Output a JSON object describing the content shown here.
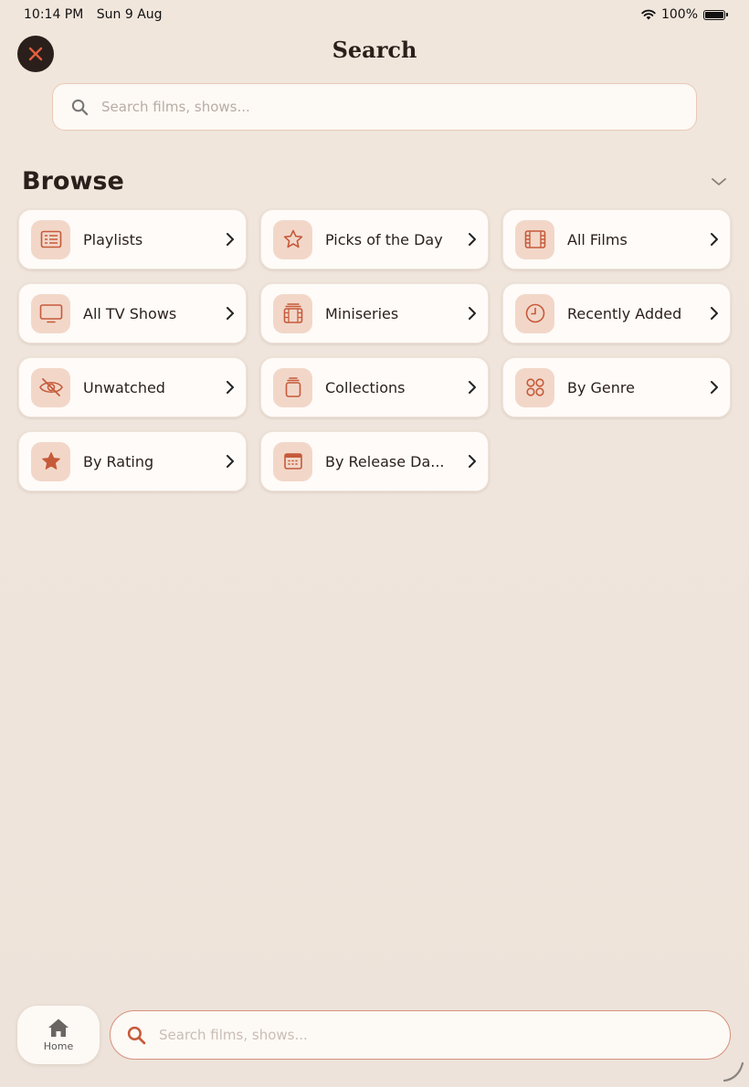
{
  "status_bar": {
    "time": "10:14 PM",
    "date": "Sun 9 Aug",
    "battery": "100%"
  },
  "header": {
    "title": "Search"
  },
  "search_top": {
    "placeholder": "Search films, shows..."
  },
  "browse": {
    "title": "Browse",
    "items": [
      {
        "label": "Playlists",
        "icon": "list-icon"
      },
      {
        "label": "Picks of the Day",
        "icon": "star-outline-icon"
      },
      {
        "label": "All Films",
        "icon": "film-icon"
      },
      {
        "label": "All TV Shows",
        "icon": "tv-icon"
      },
      {
        "label": "Miniseries",
        "icon": "film-stack-icon"
      },
      {
        "label": "Recently Added",
        "icon": "clock-icon"
      },
      {
        "label": "Unwatched",
        "icon": "eye-slash-icon"
      },
      {
        "label": "Collections",
        "icon": "stack-icon"
      },
      {
        "label": "By Genre",
        "icon": "grid-circles-icon"
      },
      {
        "label": "By Rating",
        "icon": "star-filled-icon"
      },
      {
        "label": "By Release Da...",
        "icon": "calendar-icon"
      }
    ]
  },
  "bottom_bar": {
    "home_label": "Home",
    "search_placeholder": "Search films, shows..."
  },
  "colors": {
    "accent": "#c65a3a",
    "icon_bg": "#f2d7c9",
    "background": "#efe5dc",
    "close_bg": "#2b1f1b"
  }
}
